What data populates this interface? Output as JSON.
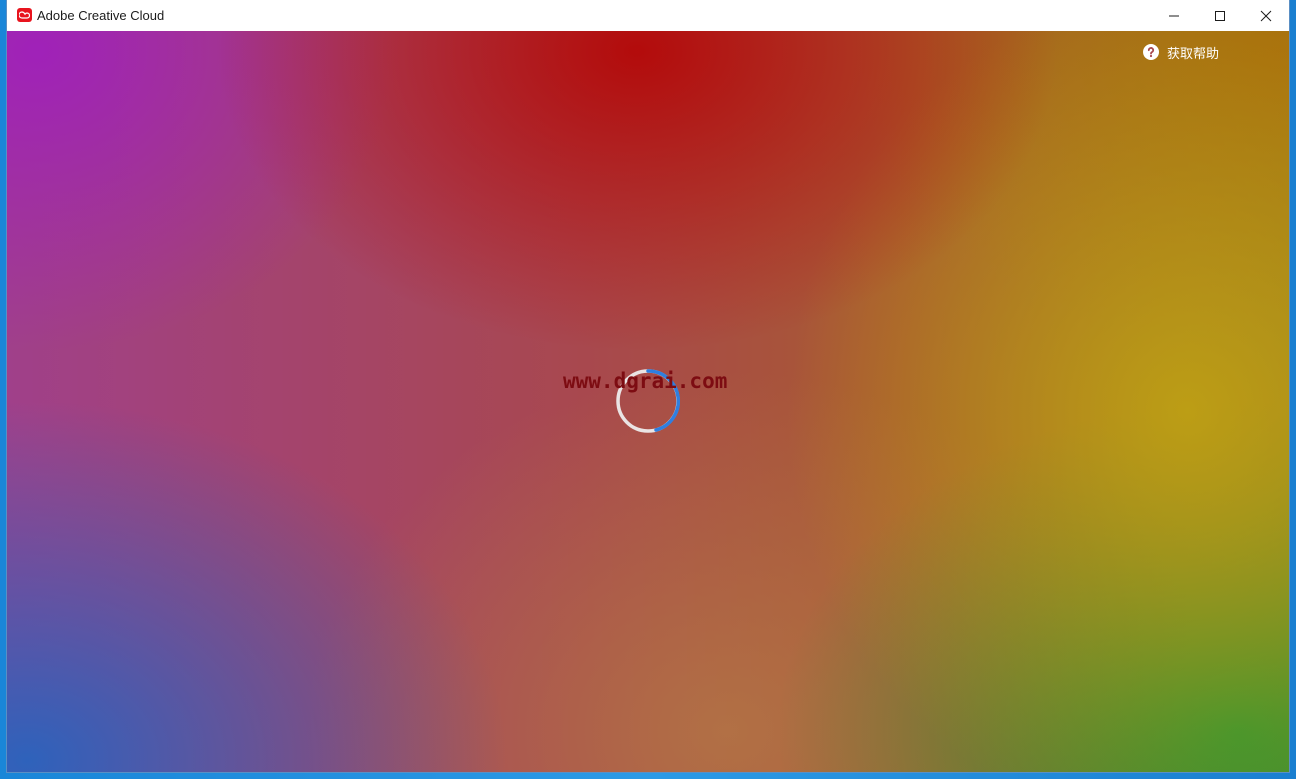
{
  "window": {
    "title": "Adobe Creative Cloud"
  },
  "controls": {
    "minimize": "minimize-icon",
    "maximize": "maximize-icon",
    "close": "close-icon"
  },
  "header": {
    "help_label": "获取帮助"
  },
  "loading": {
    "watermark": "www.dgrai.com"
  },
  "colors": {
    "brand": "#e8141e",
    "spinner_accent": "#2f7fe0"
  }
}
